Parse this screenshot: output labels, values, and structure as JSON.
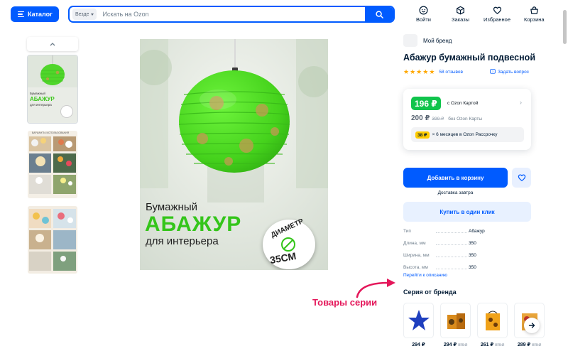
{
  "header": {
    "catalog_label": "Каталог",
    "search_scope": "Везде",
    "search_placeholder": "Искать на Ozon",
    "nav": [
      {
        "label": "Войти",
        "icon": "smile-icon"
      },
      {
        "label": "Заказы",
        "icon": "box-icon"
      },
      {
        "label": "Избранное",
        "icon": "heart-icon"
      },
      {
        "label": "Корзина",
        "icon": "basket-icon"
      }
    ]
  },
  "colors": {
    "accent": "#005bff",
    "price_green": "#10c44c",
    "annotation": "#e4175a",
    "star": "#ffa800",
    "badge_yellow": "#ffcc00"
  },
  "gallery": {
    "thumb1_text": [
      "Бумажный",
      "АБАЖУР",
      "для интерьера"
    ],
    "thumb2_text": "ВАРИАНТЫ ИСПОЛЬЗОВАНИЯ"
  },
  "main_image": {
    "line1": "Бумажный",
    "line2": "АБАЖУР",
    "line3": "для интерьера",
    "badge_top": "ДИАМЕТР",
    "badge_bottom": "35СМ"
  },
  "product": {
    "brand": "Мой бренд",
    "title": "Абажур бумажный подвесной",
    "stars": 5,
    "reviews": "58 отзывов",
    "ask": "Задать вопрос",
    "price_card": "196 ₽",
    "price_card_note": "с Ozon Картой",
    "price_nocard": "200 ₽",
    "price_old": "399 ₽",
    "price_nocard_note": "без Ozon Карты",
    "installment_badge": "38 ₽",
    "installment_text": "× 6 месяцев в Ozon Рассрочку",
    "add_to_cart": "Добавить в корзину",
    "delivery": "Доставка завтра",
    "one_click": "Купить в один клик",
    "go_to_description": "Перейти к описанию"
  },
  "specs": [
    {
      "label": "Тип",
      "value": "Абажур"
    },
    {
      "label": "Длина, мм",
      "value": "350"
    },
    {
      "label": "Ширина, мм",
      "value": "350"
    },
    {
      "label": "Высота, мм",
      "value": "350"
    }
  ],
  "series": {
    "title": "Серия от бренда",
    "annotation": "Товары серии",
    "items": [
      {
        "price": "294 ₽",
        "old": ""
      },
      {
        "price": "294 ₽",
        "old": "879 ₽"
      },
      {
        "price": "261 ₽",
        "old": "879 ₽"
      },
      {
        "price": "289 ₽",
        "old": "879 ₽"
      }
    ]
  }
}
